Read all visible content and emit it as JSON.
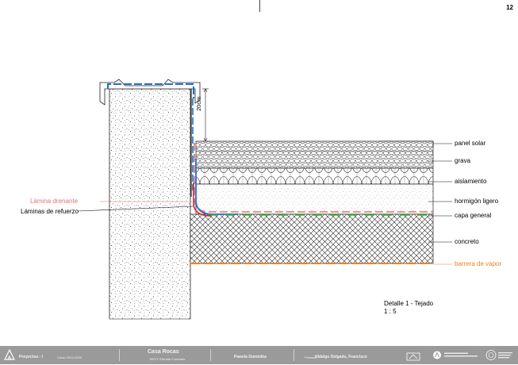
{
  "page": {
    "number": "12"
  },
  "labels": {
    "dimension": "20cm",
    "panel_solar": "panel solar",
    "grava": "grava",
    "aislamiento": "aislamiento",
    "hormigon_ligero": "hormigón ligero",
    "capa_general": "capa general",
    "concreto": "concreto",
    "barrera_de_vapor": "barrera de vapor",
    "lamina_drenante": "Lámina drenante",
    "laminas_de_refuerzo": "Láminas de refuerzo"
  },
  "detail": {
    "title": "Detalle 1 - Tejado",
    "scale": "1 : 5"
  },
  "footer": {
    "course": "Proyectos - I",
    "year": "Curso 2022-2023",
    "project_title": "Casa Rocas",
    "project_subtitle": "MKZT+Renata Furtanato",
    "student": "Pawela Dominika",
    "professor_label": "Profesor:",
    "professor_name": "Hidalgo Delgado, Francisco"
  },
  "colors": {
    "lamina_drenante": "#e8706f",
    "barrera_de_vapor": "#f08020",
    "refuerzo_blue": "#1f6fd0",
    "refuerzo_green": "#2fb82f",
    "footer_bg": "#9a9a9a"
  },
  "icons": [
    "logo-triangle-icon",
    "seal-icon",
    "university-logo-icon",
    "university-seal-icon"
  ]
}
